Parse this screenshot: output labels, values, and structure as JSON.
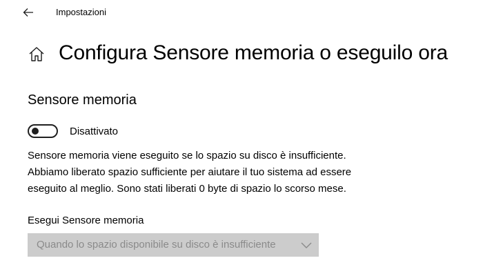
{
  "window": {
    "app_title": "Impostazioni"
  },
  "page": {
    "title": "Configura Sensore memoria o eseguilo ora"
  },
  "section": {
    "title": "Sensore memoria",
    "toggle": {
      "state": "off",
      "label": "Disattivato"
    },
    "description": "Sensore memoria viene eseguito se lo spazio su disco è insufficiente. Abbiamo liberato spazio sufficiente per aiutare il tuo sistema ad essere eseguito al meglio. Sono stati liberati 0 byte di spazio lo scorso mese.",
    "run_label": "Esegui Sensore memoria",
    "run_select": {
      "value": "Quando lo spazio disponibile su disco è insufficiente",
      "disabled": true
    }
  },
  "icons": {
    "back": "arrow-left-icon",
    "home": "home-icon",
    "dropdown": "chevron-down-icon"
  }
}
